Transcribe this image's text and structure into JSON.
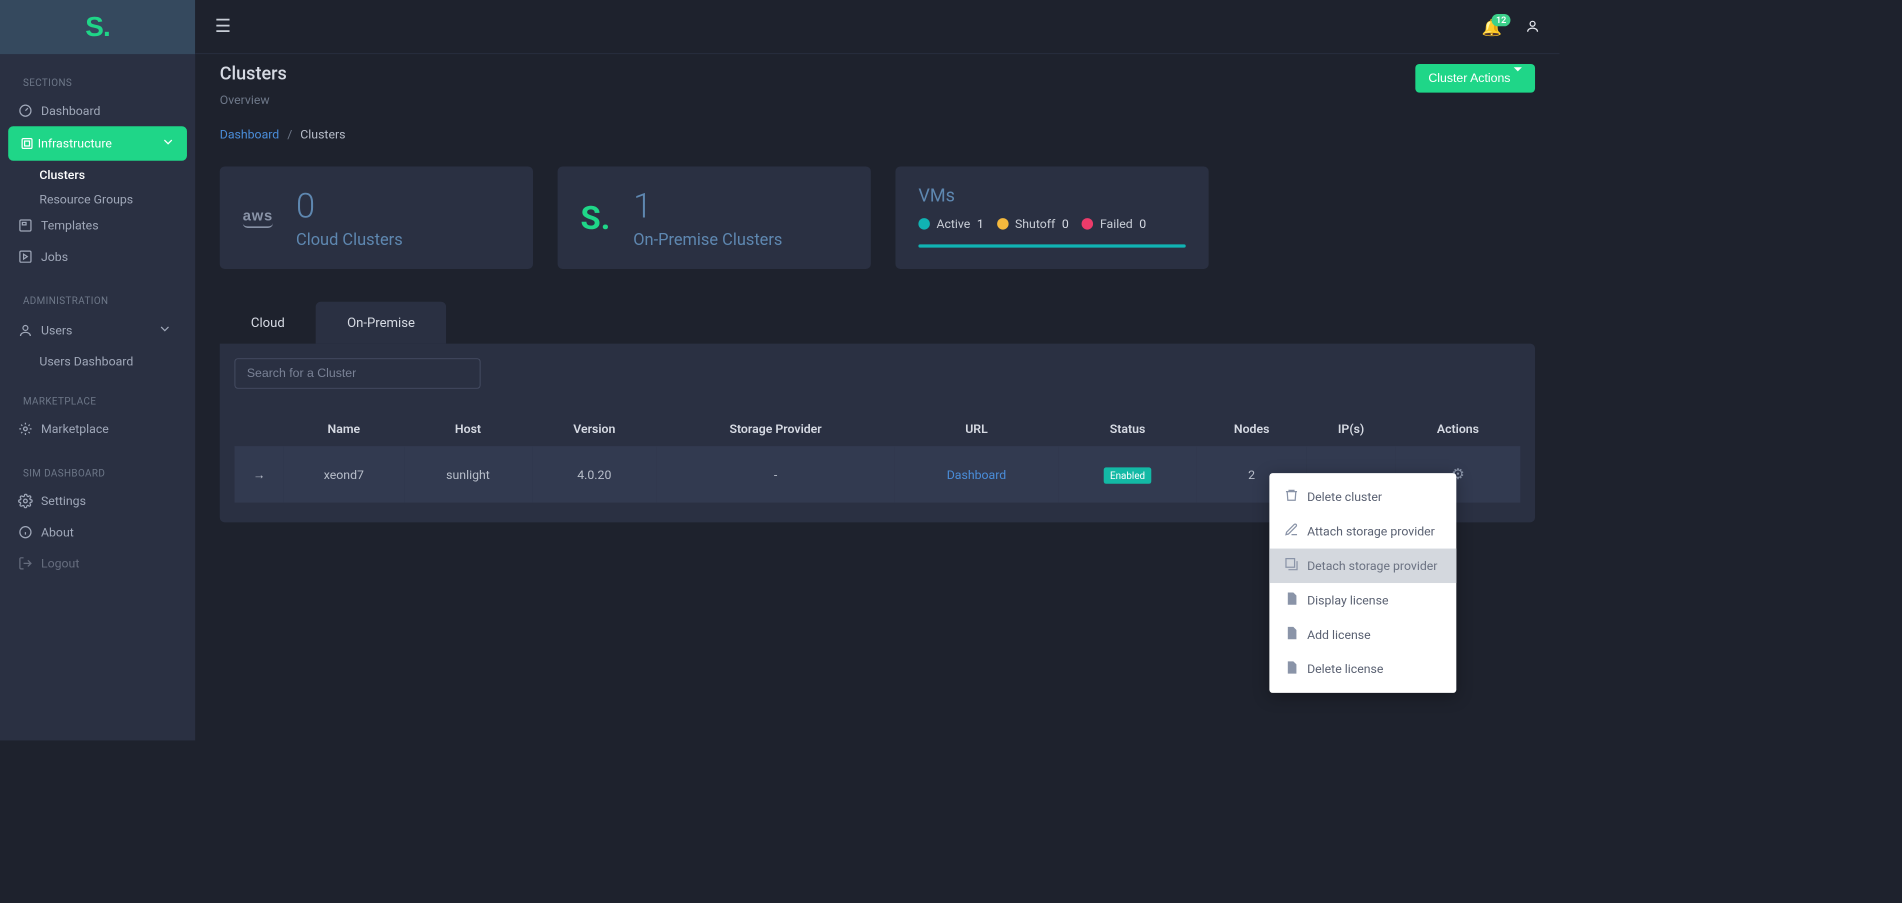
{
  "logo": "S.",
  "notifications_count": "12",
  "sidebar": {
    "sections": "SECTIONS",
    "dashboard": "Dashboard",
    "infrastructure": "Infrastructure",
    "clusters": "Clusters",
    "resource_groups": "Resource Groups",
    "templates": "Templates",
    "jobs": "Jobs",
    "administration": "ADMINISTRATION",
    "users": "Users",
    "users_dashboard": "Users Dashboard",
    "marketplace_head": "MARKETPLACE",
    "marketplace": "Marketplace",
    "sim_head": "SIM DASHBOARD",
    "settings": "Settings",
    "about": "About",
    "logout": "Logout"
  },
  "page": {
    "title": "Clusters",
    "subtitle": "Overview",
    "action_btn": "Cluster Actions"
  },
  "breadcrumb": {
    "root": "Dashboard",
    "current": "Clusters"
  },
  "cards": {
    "cloud_num": "0",
    "cloud_label": "Cloud Clusters",
    "onprem_num": "1",
    "onprem_label": "On-Premise Clusters",
    "vms_title": "VMs",
    "active_label": "Active",
    "active_val": "1",
    "shutoff_label": "Shutoff",
    "shutoff_val": "0",
    "failed_label": "Failed",
    "failed_val": "0"
  },
  "tabs": {
    "cloud": "Cloud",
    "onprem": "On-Premise"
  },
  "search": {
    "placeholder": "Search for a Cluster"
  },
  "table": {
    "headers": {
      "name": "Name",
      "host": "Host",
      "version": "Version",
      "storage": "Storage Provider",
      "url": "URL",
      "status": "Status",
      "nodes": "Nodes",
      "ips": "IP(s)",
      "actions": "Actions"
    },
    "row": {
      "name": "xeond7",
      "host": "sunlight",
      "version": "4.0.20",
      "storage": "-",
      "url": "Dashboard",
      "status": "Enabled",
      "nodes": "2",
      "ips": ""
    }
  },
  "dropdown": {
    "delete_cluster": "Delete cluster",
    "attach": "Attach storage provider",
    "detach": "Detach storage provider",
    "display_license": "Display license",
    "add_license": "Add license",
    "delete_license": "Delete license"
  }
}
